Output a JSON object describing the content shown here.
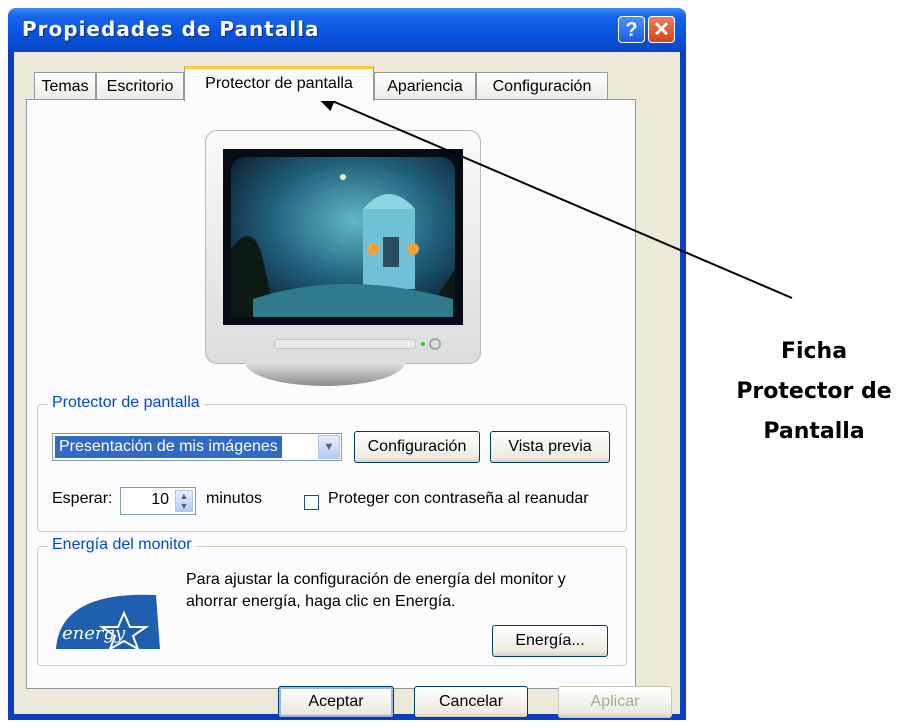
{
  "window": {
    "title": "Propiedades de Pantalla",
    "help_glyph": "?",
    "close_glyph": "✕"
  },
  "tabs": [
    {
      "label": "Temas",
      "active": false
    },
    {
      "label": "Escritorio",
      "active": false
    },
    {
      "label": "Protector de pantalla",
      "active": true
    },
    {
      "label": "Apariencia",
      "active": false
    },
    {
      "label": "Configuración",
      "active": false
    }
  ],
  "screensaver_group": {
    "legend": "Protector de pantalla",
    "selected": "Presentación de mis imágenes",
    "settings_button": "Configuración",
    "preview_button": "Vista previa",
    "wait_label": "Esperar:",
    "wait_value": "10",
    "minutes_label": "minutos",
    "password_checkbox_label": "Proteger con contraseña al reanudar",
    "password_checked": false
  },
  "power_group": {
    "legend": "Energía del monitor",
    "description_line1": "Para ajustar la configuración de energía del monitor y",
    "description_line2": "ahorrar energía, haga clic en Energía.",
    "power_button": "Energía...",
    "logo_text": "energy"
  },
  "footer": {
    "ok": "Aceptar",
    "cancel": "Cancelar",
    "apply": "Aplicar"
  },
  "annotation": {
    "line1": "Ficha",
    "line2": "Protector de",
    "line3": "Pantalla"
  },
  "colors": {
    "titlebar": "#0a55df",
    "active_tab_highlight": "#ffc83c",
    "group_label": "#0046d5",
    "selection": "#316ac5"
  }
}
